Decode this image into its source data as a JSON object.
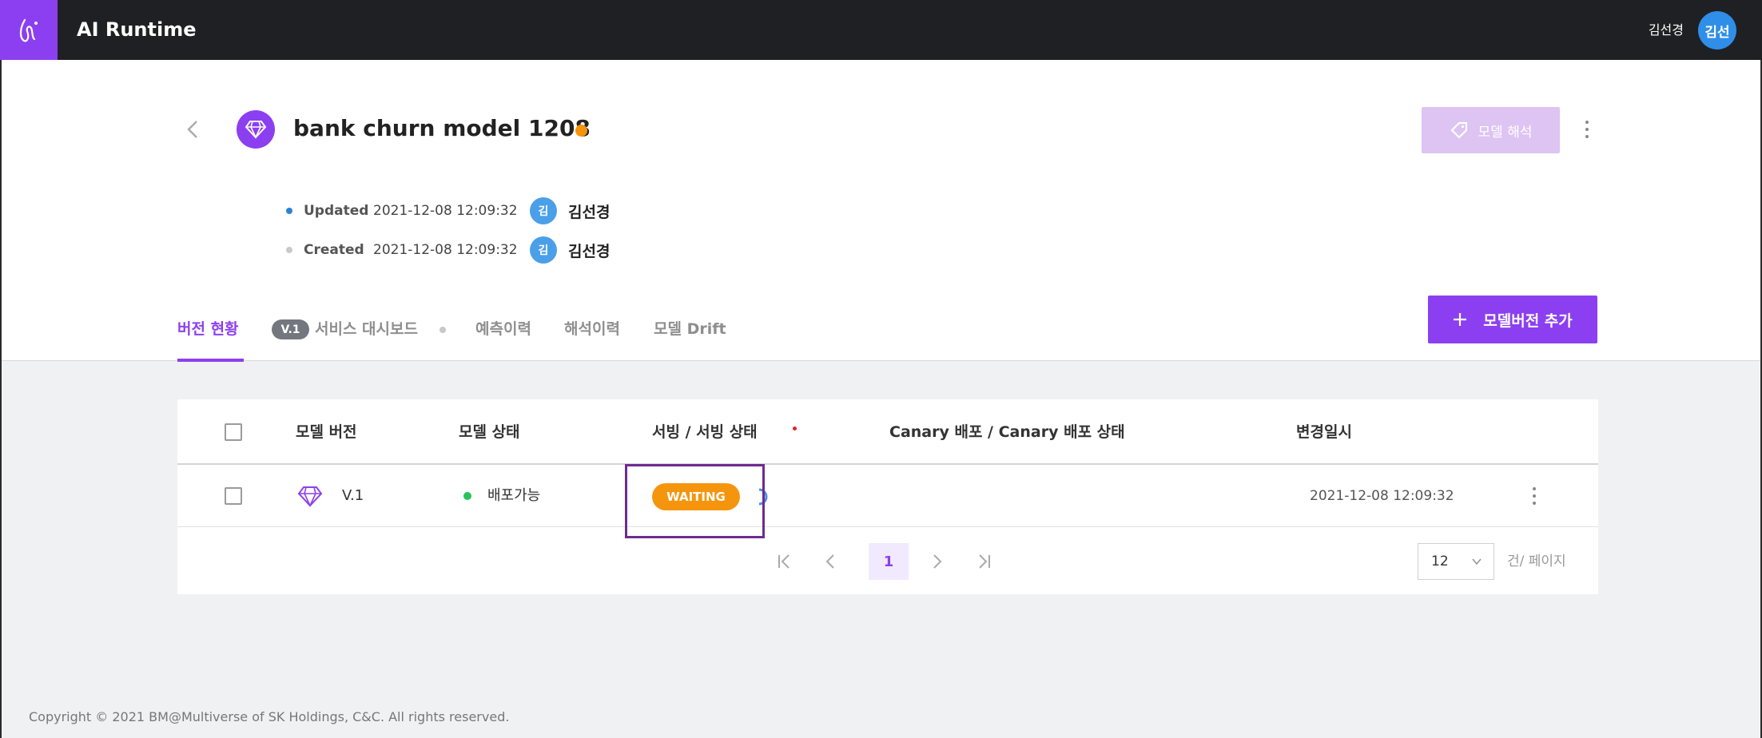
{
  "app": {
    "title": "AI Runtime"
  },
  "user": {
    "name": "김선경",
    "avatar_text": "김선"
  },
  "model": {
    "title": "bank churn model 1208",
    "status_color": "#f5930a"
  },
  "actions": {
    "interpret_label": "모델 해석",
    "add_version_label": "모델버전 추가"
  },
  "meta": {
    "updated": {
      "label": "Updated",
      "date": "2021-12-08 12:09:32",
      "avatar": "김",
      "user": "김선경"
    },
    "created": {
      "label": "Created",
      "date": "2021-12-08 12:09:32",
      "avatar": "김",
      "user": "김선경"
    }
  },
  "tabs": [
    {
      "label": "버전 현황",
      "active": true
    },
    {
      "badge": "V.1",
      "label": "서비스 대시보드"
    },
    {
      "label": "예측이력"
    },
    {
      "label": "해석이력"
    },
    {
      "label": "모델 Drift"
    }
  ],
  "table": {
    "columns": [
      "모델 버전",
      "모델 상태",
      "서빙 / 서빙 상태",
      "Canary 배포 / Canary 배포 상태",
      "변경일시"
    ],
    "rows": [
      {
        "version": "V.1",
        "status": "배포가능",
        "serving": "WAITING",
        "canary": "",
        "changed": "2021-12-08 12:09:32"
      }
    ]
  },
  "pagination": {
    "current": "1",
    "page_size": "12",
    "unit": "건/ 페이지"
  },
  "footer": {
    "copyright": "Copyright © 2021 BM@Multiverse of SK Holdings, C&C. All rights reserved."
  },
  "colors": {
    "accent": "#8c3ff0",
    "waiting": "#f5950d",
    "available": "#26c45b"
  }
}
